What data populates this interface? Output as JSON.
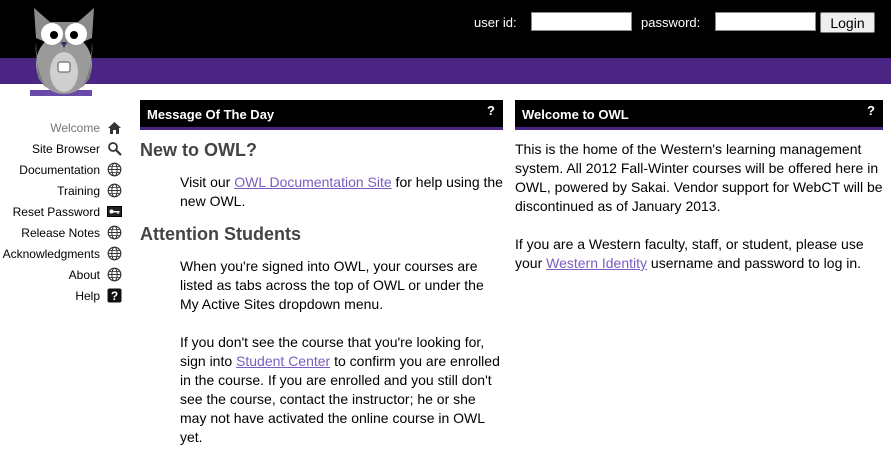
{
  "header": {
    "user_id_label": "user id:",
    "password_label": "password:",
    "login_button": "Login",
    "brand_color": "#4b2583"
  },
  "nav": {
    "items": [
      {
        "label": "Welcome",
        "icon": "home-icon",
        "active": true
      },
      {
        "label": "Site Browser",
        "icon": "search-icon"
      },
      {
        "label": "Documentation",
        "icon": "globe-icon"
      },
      {
        "label": "Training",
        "icon": "globe-icon"
      },
      {
        "label": "Reset Password",
        "icon": "key-icon"
      },
      {
        "label": "Release Notes",
        "icon": "globe-icon"
      },
      {
        "label": "Acknowledgments",
        "icon": "globe-icon"
      },
      {
        "label": "About",
        "icon": "globe-icon"
      },
      {
        "label": "Help",
        "icon": "question-icon"
      }
    ]
  },
  "motd": {
    "title": "Message Of The Day",
    "help": "?",
    "new_heading": "New to OWL?",
    "new_text_before": "Visit our ",
    "new_link": "OWL Documentation Site",
    "new_text_after": " for help using the new OWL.",
    "attention_heading": "Attention Students",
    "attention_p1": "When you're signed into OWL, your courses are listed as tabs across the top of OWL or under the My Active Sites dropdown menu.",
    "attention_p2_before": "If you don't see the course that you're looking for, sign into ",
    "attention_p2_link": "Student Center",
    "attention_p2_after": " to confirm you are enrolled in the course. If you are enrolled and you still don't see the course, contact the instructor; he or she may not have activated the online course in OWL yet."
  },
  "welcome": {
    "title": "Welcome to OWL",
    "help": "?",
    "p1": "This is the home of the Western's learning management system. All 2012 Fall-Winter courses will be offered here in OWL, powered by Sakai. Vendor support for WebCT will be discontinued as of January 2013.",
    "p2_before": "If you are a Western faculty, staff, or student, please use your ",
    "p2_link": "Western Identity",
    "p2_after": " username and password to log in."
  }
}
